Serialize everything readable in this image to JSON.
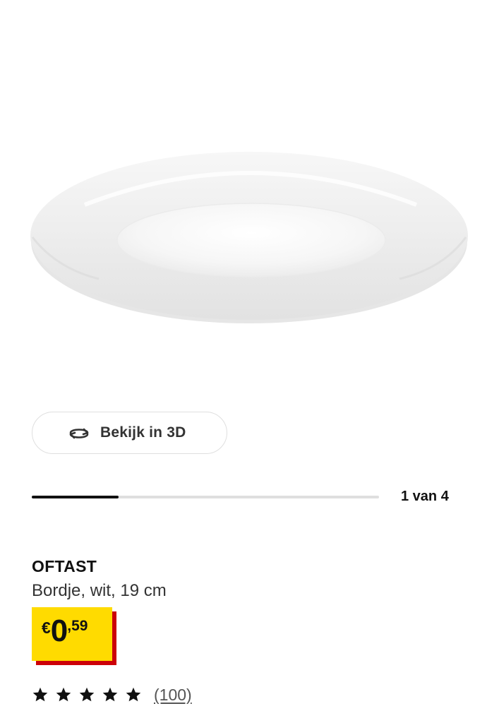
{
  "product_image": {
    "icon": "plate-image",
    "alt": ""
  },
  "view_3d": {
    "label": "Bekijk in 3D",
    "icon": "rotate-3d-icon"
  },
  "carousel": {
    "counter": "1 van 4",
    "current": 1,
    "total": 4,
    "progress_fraction": 0.25
  },
  "product": {
    "name": "OFTAST",
    "description": "Bordje, wit, 19 cm"
  },
  "price": {
    "currency": "€",
    "integer": "0",
    "decimal": ",59",
    "tag_color": "#ffdb00",
    "shadow_color": "#cc0008"
  },
  "rating": {
    "stars": 5,
    "max": 5,
    "reviews": "(100)"
  }
}
